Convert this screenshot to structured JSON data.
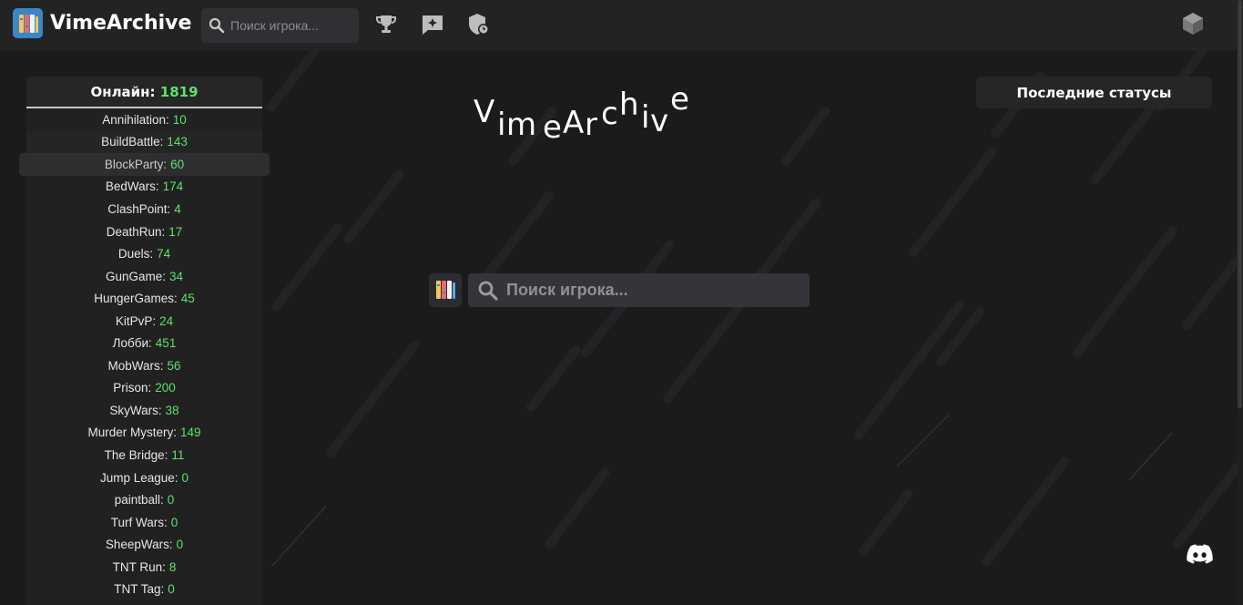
{
  "header": {
    "app_title": "VimeArchive",
    "search_placeholder": "Поиск игрока...",
    "icons": [
      "logo-books-icon",
      "search-icon",
      "trophy-icon",
      "feedback-sparkle-icon",
      "shield-clock-icon",
      "minecraft-cube-icon"
    ]
  },
  "sidebar": {
    "online_label": "Онлайн:",
    "online_count": "1819",
    "modes": [
      {
        "name": "Annihilation:",
        "count": "10"
      },
      {
        "name": "BuildBattle:",
        "count": "143"
      },
      {
        "name": "BlockParty:",
        "count": "60"
      },
      {
        "name": "BedWars:",
        "count": "174"
      },
      {
        "name": "ClashPoint:",
        "count": "4"
      },
      {
        "name": "DeathRun:",
        "count": "17"
      },
      {
        "name": "Duels:",
        "count": "74"
      },
      {
        "name": "GunGame:",
        "count": "34"
      },
      {
        "name": "HungerGames:",
        "count": "45"
      },
      {
        "name": "KitPvP:",
        "count": "24"
      },
      {
        "name": "Лобби:",
        "count": "451"
      },
      {
        "name": "MobWars:",
        "count": "56"
      },
      {
        "name": "Prison:",
        "count": "200"
      },
      {
        "name": "SkyWars:",
        "count": "38"
      },
      {
        "name": "Murder Mystery:",
        "count": "149"
      },
      {
        "name": "The Bridge:",
        "count": "11"
      },
      {
        "name": "Jump League:",
        "count": "0"
      },
      {
        "name": "paintball:",
        "count": "0"
      },
      {
        "name": "Turf Wars:",
        "count": "0"
      },
      {
        "name": "SheepWars:",
        "count": "0"
      },
      {
        "name": "TNT Run:",
        "count": "8"
      },
      {
        "name": "TNT Tag:",
        "count": "0"
      }
    ]
  },
  "statuses": {
    "label": "Последние статусы"
  },
  "main": {
    "search_placeholder": "Поиск игрока..."
  },
  "colors": {
    "accent_green": "#5ee16a",
    "background": "#1b1b1c",
    "header": "#232324",
    "logo_blue": "#3b86c7"
  }
}
